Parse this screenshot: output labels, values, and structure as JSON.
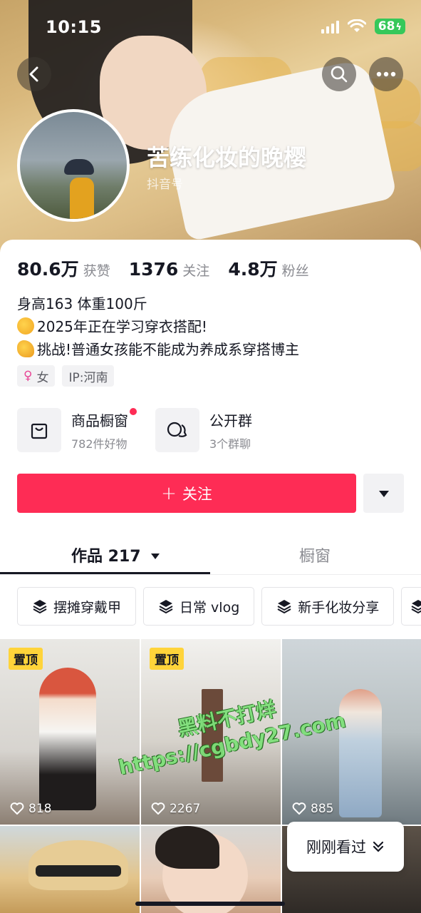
{
  "status_bar": {
    "time": "10:15",
    "battery": "68"
  },
  "header": {
    "username": "苦练化妆的晚樱",
    "douyin_id_label": "抖音号"
  },
  "stats": [
    {
      "value": "80.6万",
      "label": "获赞"
    },
    {
      "value": "1376",
      "label": "关注"
    },
    {
      "value": "4.8万",
      "label": "粉丝"
    }
  ],
  "bio": {
    "line1": "身高163 体重100斤",
    "line2": "2025年正在学习穿衣搭配!",
    "line3": "挑战!普通女孩能不能成为养成系穿搭博主"
  },
  "tags": {
    "gender": "女",
    "ip": "IP:河南"
  },
  "entries": [
    {
      "title": "商品橱窗",
      "subtitle": "782件好物"
    },
    {
      "title": "公开群",
      "subtitle": "3个群聊"
    }
  ],
  "actions": {
    "follow_label": "关注"
  },
  "tabs": {
    "works_label": "作品 217",
    "shop_label": "橱窗"
  },
  "collections": [
    "摆摊穿戴甲",
    "日常 vlog",
    "新手化妆分享"
  ],
  "videos": [
    {
      "pinned_label": "置顶",
      "likes": "818"
    },
    {
      "pinned_label": "置顶",
      "likes": "2267"
    },
    {
      "likes": "885"
    }
  ],
  "watermark": {
    "line1": "黑料不打烊",
    "line2": "https://cgbdy27.com"
  },
  "recent_label": "刚刚看过",
  "colors": {
    "accent": "#fe2c55",
    "pin_badge": "#ffd43a",
    "battery": "#36c85a"
  }
}
